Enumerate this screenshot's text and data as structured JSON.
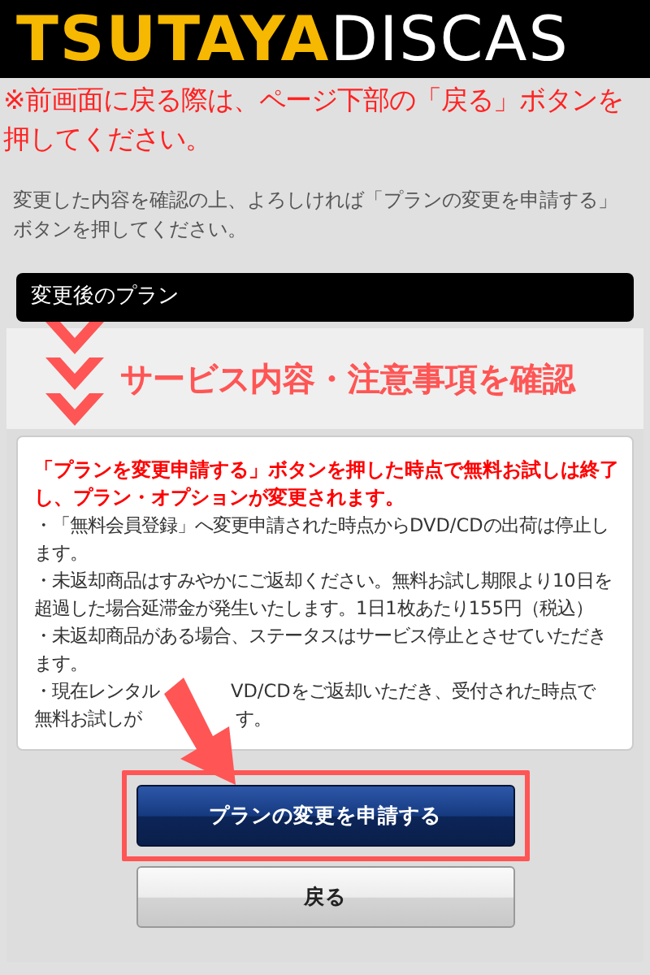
{
  "header": {
    "logo_left": "TSUTAYA",
    "logo_right": "DISCAS"
  },
  "back_notice": "※前画面に戻る際は、ページ下部の「戻る」ボタンを押してください。",
  "instruction": "変更した内容を確認の上、よろしければ「プランの変更を申請する」ボタンを押してください。",
  "section_bar": "変更後のプラン",
  "callout": {
    "title": "サービス内容・注意事項を確認"
  },
  "card": {
    "warning": "「プランを変更申請する」ボタンを押した時点で無料お試しは終了し、プラン・オプションが変更されます。",
    "bullets": [
      {
        "kind": "text",
        "text": "・「無料会員登録」へ変更申請された時点からDVD/CDの出荷は停止します。"
      },
      {
        "kind": "text",
        "text": "・未返却商品はすみやかにご返却ください。無料お試し期限より10日を超過した場合延滞金が発生いたします。1日1枚あたり155円（税込）"
      },
      {
        "kind": "text",
        "text": "・未返却商品がある場合、ステータスはサービス停止とさせていただきます。"
      },
      {
        "kind": "covered",
        "lines": [
          [
            "・現在レンタル",
            "VD/CDをご返却いただき、受付された時点で"
          ],
          [
            "無料お試しが",
            "す。"
          ]
        ]
      }
    ]
  },
  "buttons": [
    {
      "kind": "primary",
      "label": "プランの変更を申請する",
      "highlighted": true
    },
    {
      "kind": "secondary",
      "label": "戻る",
      "highlighted": false
    }
  ]
}
